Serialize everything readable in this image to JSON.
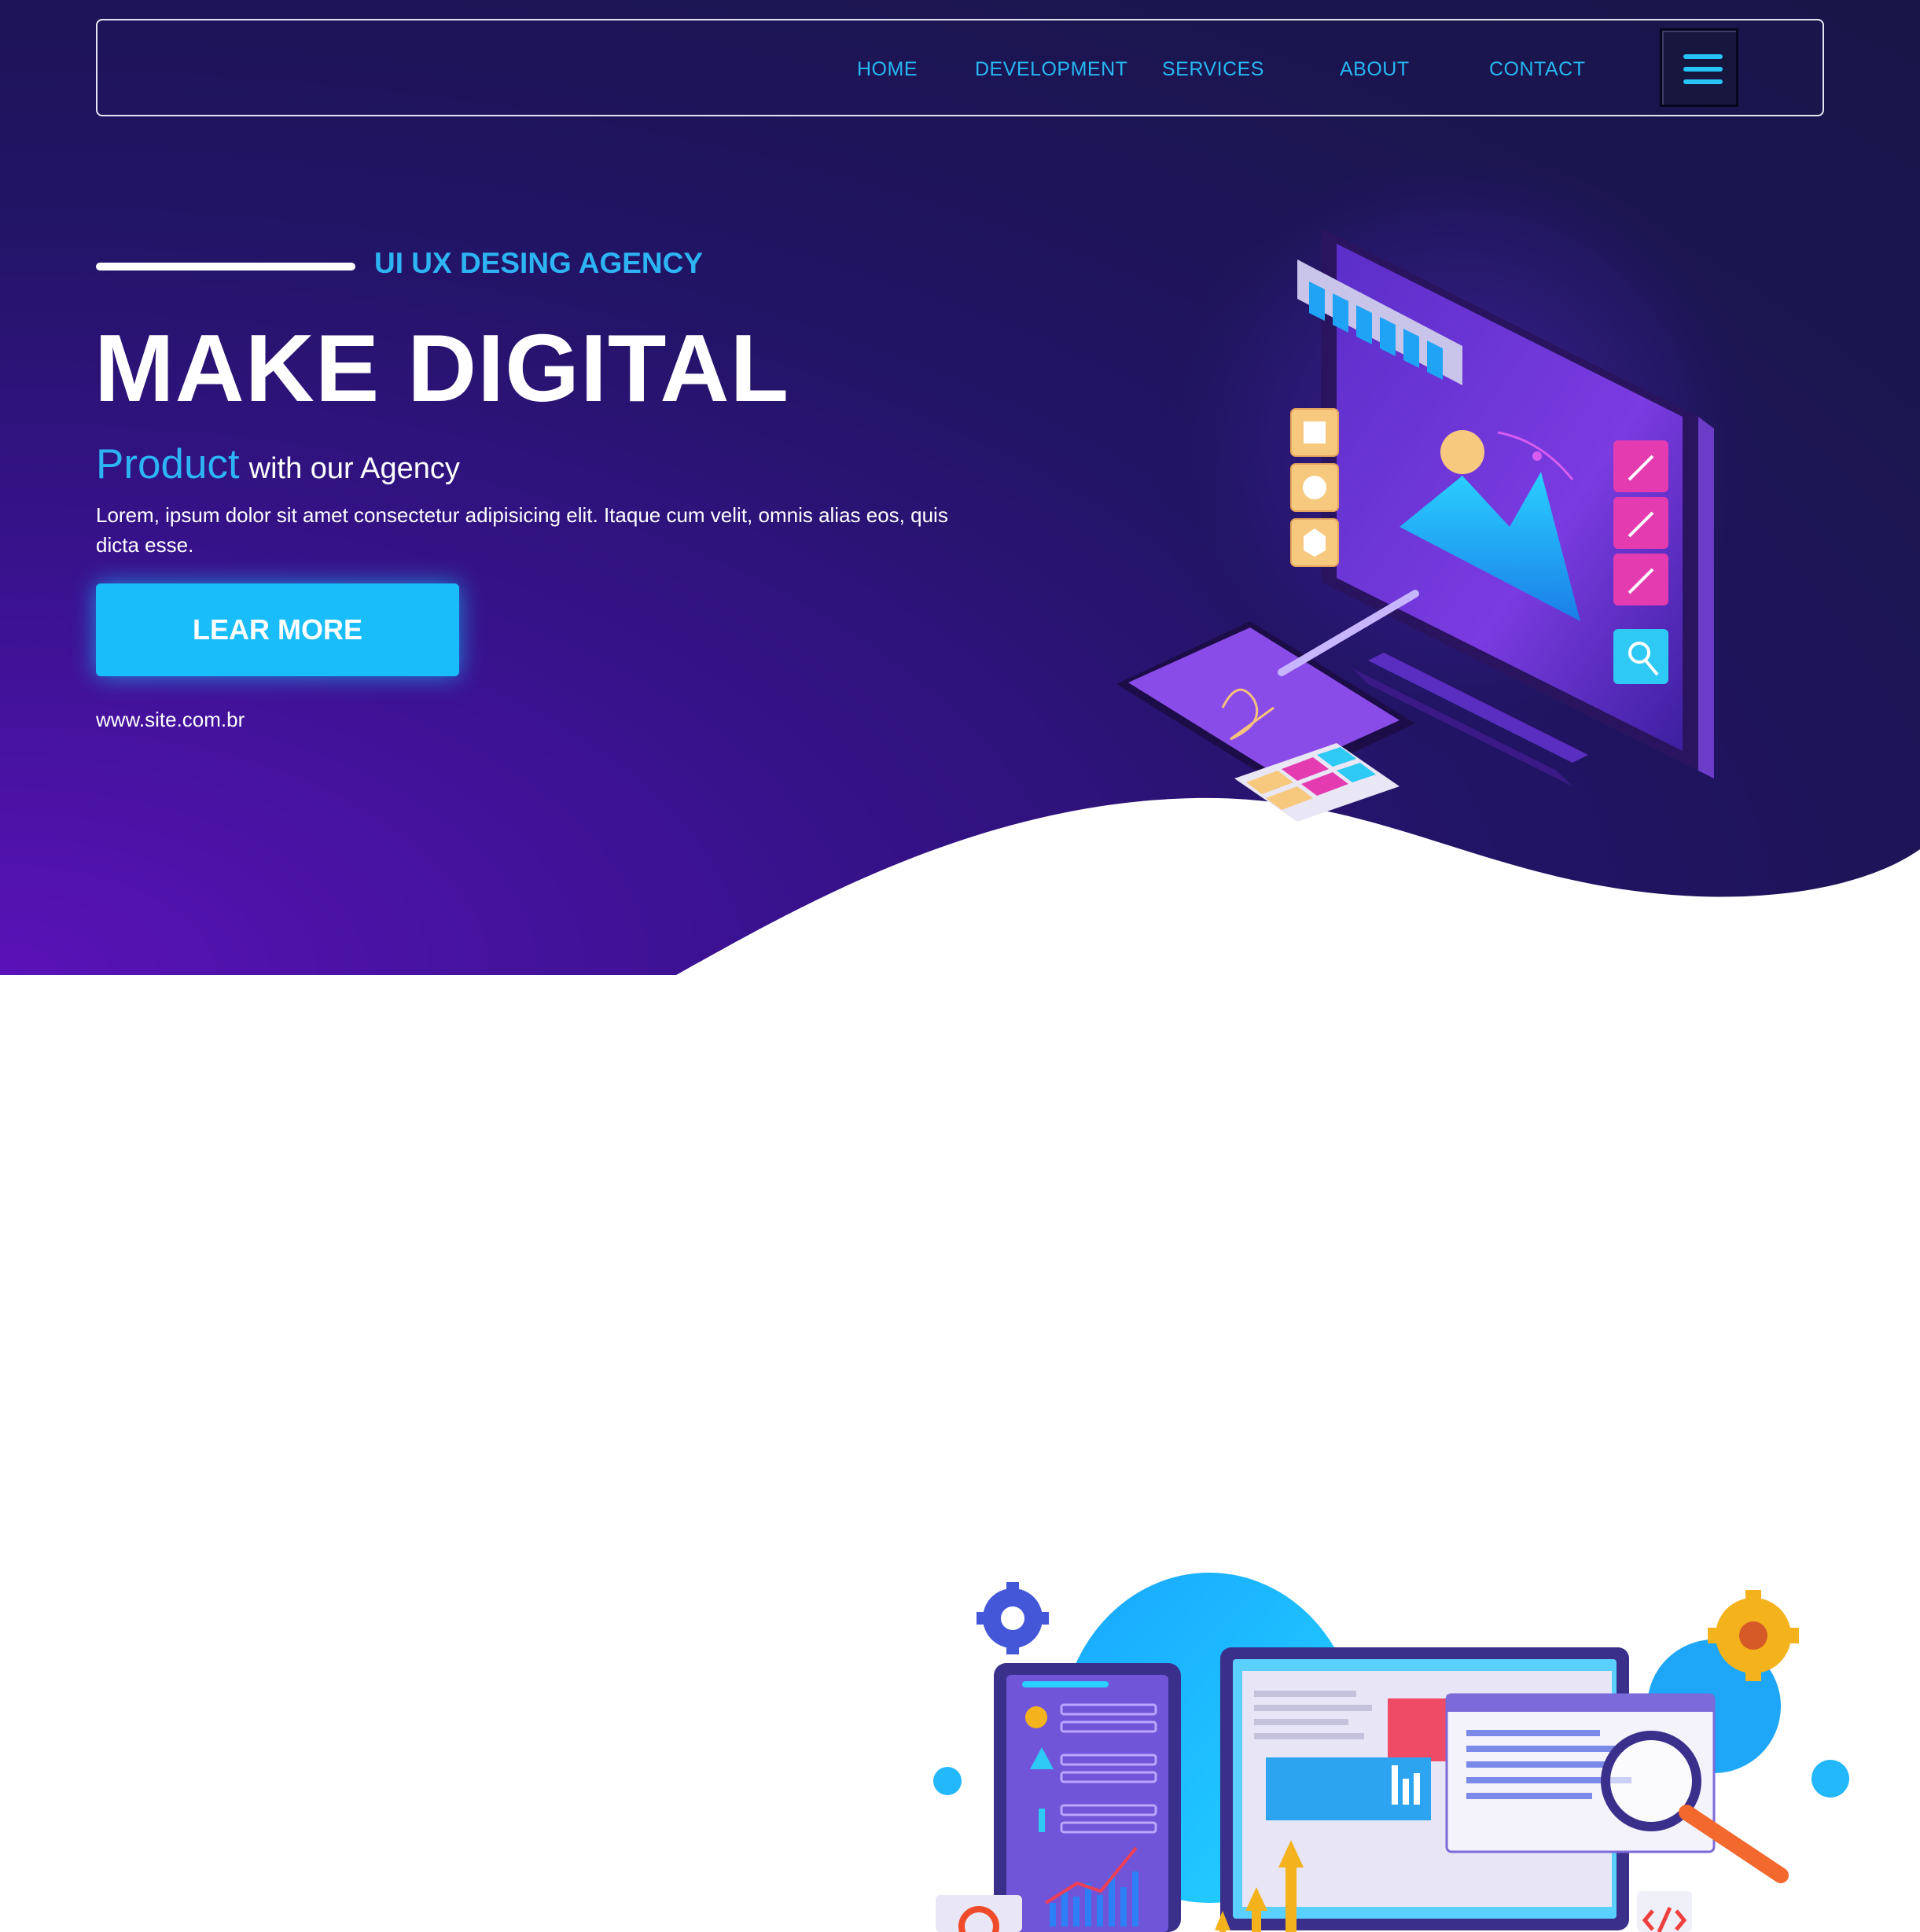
{
  "nav": {
    "links": [
      "HOME",
      "DEVELOPMENT",
      "SERVICES",
      "ABOUT",
      "CONTACT"
    ],
    "menu_icon": "hamburger-menu-icon"
  },
  "hero": {
    "tagline": "UI UX DESING AGENCY",
    "title": "MAKE DIGITAL",
    "subtitle_highlight": "Product",
    "subtitle_rest": "with our Agency",
    "description": "Lorem, ipsum dolor sit amet consectetur adipisicing elit. Itaque cum velit, omnis alias eos, quis dicta esse.",
    "cta_label": "LEAR MORE",
    "site_url": "www.site.com.br"
  },
  "illustrations": {
    "hero": "isometric-design-monitor-illustration",
    "lower": "analytics-devices-illustration"
  },
  "colors": {
    "accent": "#26b7f2",
    "button": "#18bdfa",
    "hero_dark": "#1b1550",
    "hero_purple": "#5a12b8",
    "text_light": "#ffffff"
  }
}
